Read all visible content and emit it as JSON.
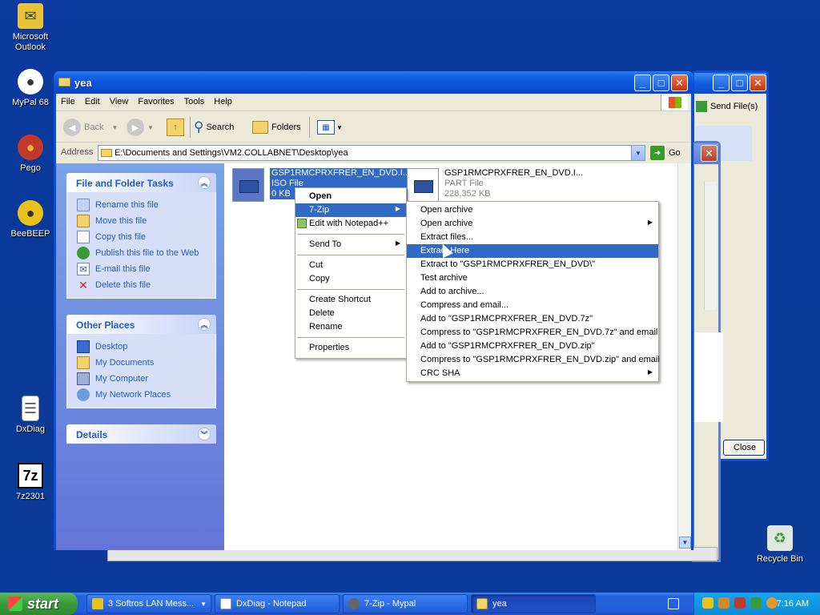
{
  "desktop": {
    "icons": [
      {
        "label": "Microsoft Outlook",
        "glyph": "✉",
        "color": "#e9c13b"
      },
      {
        "label": "MyPal 68",
        "glyph": "●",
        "color": "#666666"
      },
      {
        "label": "Pego",
        "glyph": "●",
        "color": "#c0392b"
      },
      {
        "label": "BeeBEEP",
        "glyph": "●",
        "color": "#e8c21a"
      },
      {
        "label": "DxDiag",
        "glyph": "☰",
        "color": "#ffffff"
      },
      {
        "label": "7z2301",
        "glyph": "7z",
        "color": "#ffffff"
      },
      {
        "label": "Recycle Bin",
        "glyph": "♻",
        "color": "#3a9a3a"
      }
    ]
  },
  "back_window": {
    "send_files": "Send File(s)",
    "close_label": "Close"
  },
  "explorer": {
    "title": "yea",
    "menu": [
      "File",
      "Edit",
      "View",
      "Favorites",
      "Tools",
      "Help"
    ],
    "toolbar": {
      "back": "Back",
      "search": "Search",
      "folders": "Folders"
    },
    "address_label": "Address",
    "address": "E:\\Documents and Settings\\VM2.COLLABNET\\Desktop\\yea",
    "go": "Go",
    "tasks_panel": {
      "title": "File and Folder Tasks",
      "items": [
        "Rename this file",
        "Move this file",
        "Copy this file",
        "Publish this file to the Web",
        "E-mail this file",
        "Delete this file"
      ]
    },
    "places_panel": {
      "title": "Other Places",
      "items": [
        "Desktop",
        "My Documents",
        "My Computer",
        "My Network Places"
      ]
    },
    "details_panel": {
      "title": "Details"
    },
    "files": [
      {
        "name": "GSP1RMCPRXFRER_EN_DVD.I...",
        "type": "ISO File",
        "size": "0 KB",
        "selected": true
      },
      {
        "name": "GSP1RMCPRXFRER_EN_DVD.I...",
        "type": "PART File",
        "size": "228,352 KB",
        "selected": false
      }
    ]
  },
  "context_menu": {
    "items": [
      "Open",
      "7-Zip",
      "Edit with Notepad++",
      "Send To",
      "Cut",
      "Copy",
      "Create Shortcut",
      "Delete",
      "Rename",
      "Properties"
    ]
  },
  "zip_submenu": {
    "items": [
      "Open archive",
      "Open archive",
      "Extract files...",
      "Extract Here",
      "Extract to \"GSP1RMCPRXFRER_EN_DVD\\\"",
      "Test archive",
      "Add to archive...",
      "Compress and email...",
      "Add to \"GSP1RMCPRXFRER_EN_DVD.7z\"",
      "Compress to \"GSP1RMCPRXFRER_EN_DVD.7z\" and email",
      "Add to \"GSP1RMCPRXFRER_EN_DVD.zip\"",
      "Compress to \"GSP1RMCPRXFRER_EN_DVD.zip\" and email",
      "CRC SHA"
    ]
  },
  "taskbar": {
    "start": "start",
    "tasks": [
      "3 Softros LAN Mess...",
      "DxDiag - Notepad",
      "7-Zip - Mypal",
      "yea"
    ],
    "clock": "7:16 AM"
  }
}
